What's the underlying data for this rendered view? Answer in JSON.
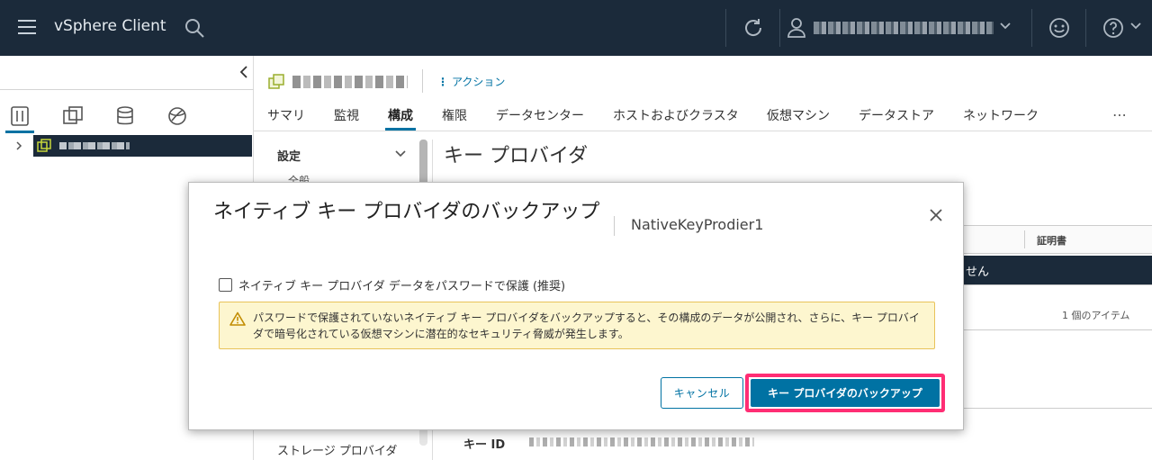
{
  "header": {
    "app_title": "vSphere Client",
    "icons": [
      "hamburger-icon",
      "search-icon",
      "refresh-icon",
      "user-icon",
      "smile-icon",
      "help-icon"
    ]
  },
  "breadcrumb": {
    "actions_label": "アクション"
  },
  "tabs": [
    "サマリ",
    "監視",
    "構成",
    "権限",
    "データセンター",
    "ホストおよびクラスタ",
    "仮想マシン",
    "データストア",
    "ネットワーク"
  ],
  "active_tab": "構成",
  "more_label": "⋯",
  "settings_nav": {
    "section_title": "設定",
    "sub_item": "全般",
    "storage_item": "ストレージ プロバイダ"
  },
  "content": {
    "page_title": "キー プロバイダ",
    "cert_column": "証明書",
    "dark_row_text": "せん",
    "item_count": "1 個のアイテム",
    "key_id_label": "キー ID"
  },
  "modal": {
    "title": "ネイティブ キー プロバイダのバックアップ",
    "subtitle": "NativeKeyProdier1",
    "checkbox_label": "ネイティブ キー プロバイダ データをパスワードで保護 (推奨)",
    "checkbox_checked": false,
    "warning_text": "パスワードで保護されていないネイティブ キー プロバイダをバックアップすると、その構成のデータが公開され、さらに、キー プロバイダで暗号化されている仮想マシンに潜在的なセキュリティ脅威が発生します。",
    "cancel_label": "キャンセル",
    "primary_label": "キー プロバイダのバックアップ"
  },
  "colors": {
    "header_bg": "#1b2a3a",
    "accent": "#0072a3",
    "highlight": "#ff2d74",
    "warning_bg": "#fdf6cf",
    "warning_border": "#e8c35a"
  }
}
